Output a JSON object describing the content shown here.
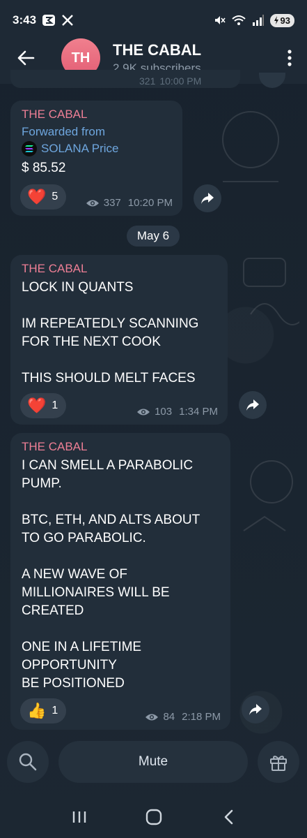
{
  "status_bar": {
    "time": "3:43",
    "battery": "93",
    "icons": [
      "mute-icon",
      "wifi-icon",
      "signal-icon",
      "battery-icon",
      "app-notification-icon",
      "x-logo-icon"
    ]
  },
  "header": {
    "avatar_initials": "TH",
    "channel_name": "THE CABAL",
    "subscribers": "2.9K subscribers"
  },
  "previous_message_meta": {
    "views": "321",
    "time": "10:00 PM"
  },
  "messages": [
    {
      "sender": "THE CABAL",
      "forwarded_label": "Forwarded from",
      "forwarded_source": "SOLANA Price",
      "text": "$ 85.52",
      "reaction_emoji": "❤️",
      "reaction_count": "5",
      "views": "337",
      "time": "10:20 PM"
    },
    {
      "sender": "THE CABAL",
      "text": "LOCK IN QUANTS\n\nIM REPEATEDLY SCANNING\nFOR THE NEXT COOK\n\nTHIS SHOULD MELT FACES",
      "reaction_emoji": "❤️",
      "reaction_count": "1",
      "views": "103",
      "time": "1:34 PM"
    },
    {
      "sender": "THE CABAL",
      "text": "I CAN SMELL A PARABOLIC\nPUMP.\n\nBTC, ETH, AND ALTS ABOUT\nTO GO PARABOLIC.\n\nA NEW WAVE OF\nMILLIONAIRES WILL BE\nCREATED\n\nONE IN A LIFETIME\nOPPORTUNITY\nBE POSITIONED",
      "reaction_emoji": "👍",
      "reaction_count": "1",
      "views": "84",
      "time": "2:18 PM"
    }
  ],
  "date_separator": "May 6",
  "bottom_bar": {
    "mute_label": "Mute"
  },
  "colors": {
    "background": "#1b2530",
    "bubble": "#222e3a",
    "sender": "#ee7f95",
    "forwarded": "#6ea6de",
    "meta": "#8d9aa8"
  }
}
